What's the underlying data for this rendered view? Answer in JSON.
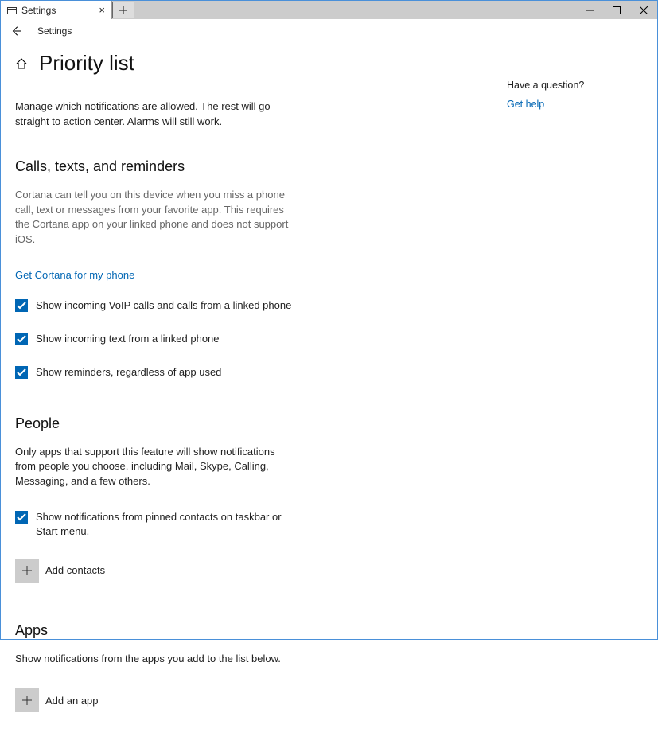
{
  "titlebar": {
    "tab_title": "Settings"
  },
  "nav": {
    "breadcrumb": "Settings"
  },
  "page_title": "Priority list",
  "intro": "Manage which notifications are allowed. The rest will go straight to action center. Alarms will still work.",
  "section_calls": {
    "title": "Calls, texts, and reminders",
    "desc": "Cortana can tell you on this device when you miss a phone call, text or messages from your favorite app. This requires the Cortana app on your linked phone and does not support iOS.",
    "link": "Get Cortana for my phone",
    "check1": "Show incoming VoIP calls and calls from a linked phone",
    "check2": "Show incoming text from a linked phone",
    "check3": "Show reminders, regardless of app used"
  },
  "section_people": {
    "title": "People",
    "desc": "Only apps that support this feature will show notifications from people you choose, including Mail, Skype, Calling, Messaging, and a few others.",
    "check1": "Show notifications from pinned contacts on taskbar or Start menu.",
    "add_label": "Add contacts"
  },
  "section_apps": {
    "title": "Apps",
    "desc": "Show notifications from the apps you add to the list below.",
    "add_label": "Add an app"
  },
  "side": {
    "question": "Have a question?",
    "help": "Get help"
  }
}
